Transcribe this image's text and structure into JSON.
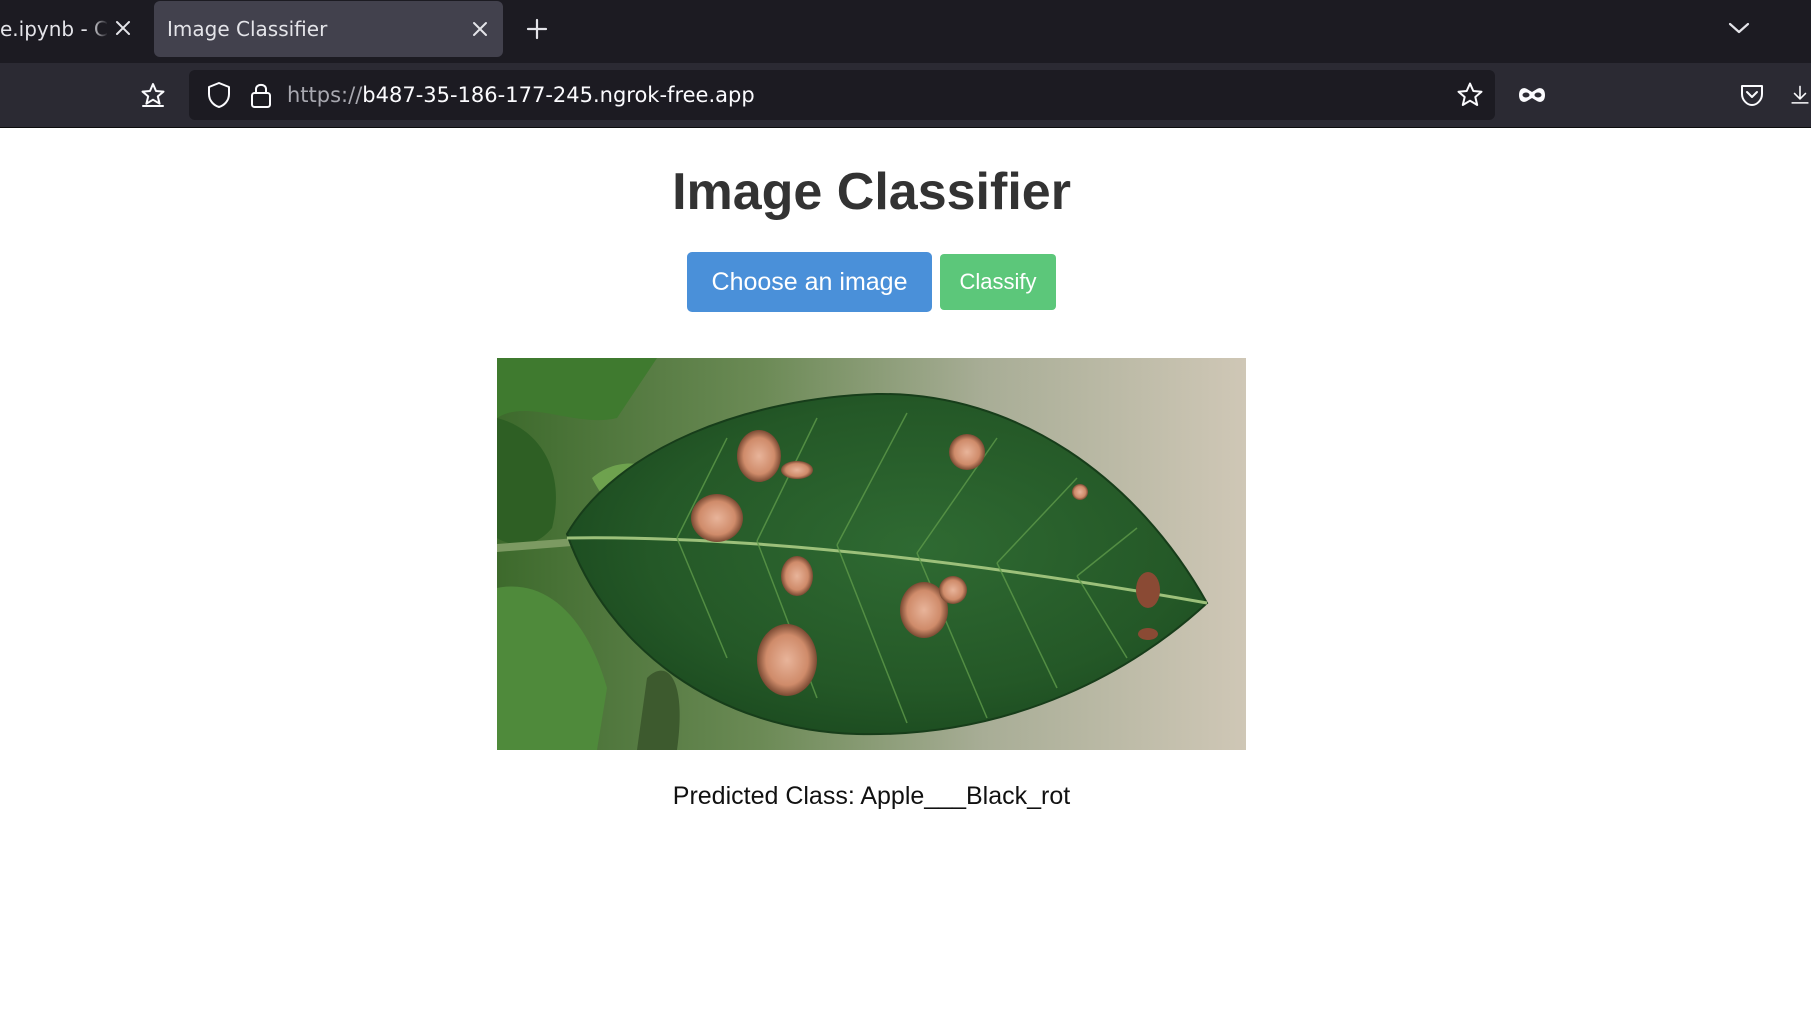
{
  "browser": {
    "tabs": [
      {
        "title": "e.ipynb - Colab",
        "active": false
      },
      {
        "title": "Image Classifier",
        "active": true
      }
    ],
    "url_scheme": "https://",
    "url_host": "b487-35-186-177-245.ngrok-free.app"
  },
  "page": {
    "title": "Image Classifier",
    "choose_label": "Choose an image",
    "classify_label": "Classify",
    "prediction_text": "Predicted Class: Apple___Black_rot"
  },
  "colors": {
    "choose_button": "#4a90d9",
    "classify_button": "#5cc77a",
    "tabbar": "#1c1b22",
    "navbar": "#2b2a33"
  }
}
